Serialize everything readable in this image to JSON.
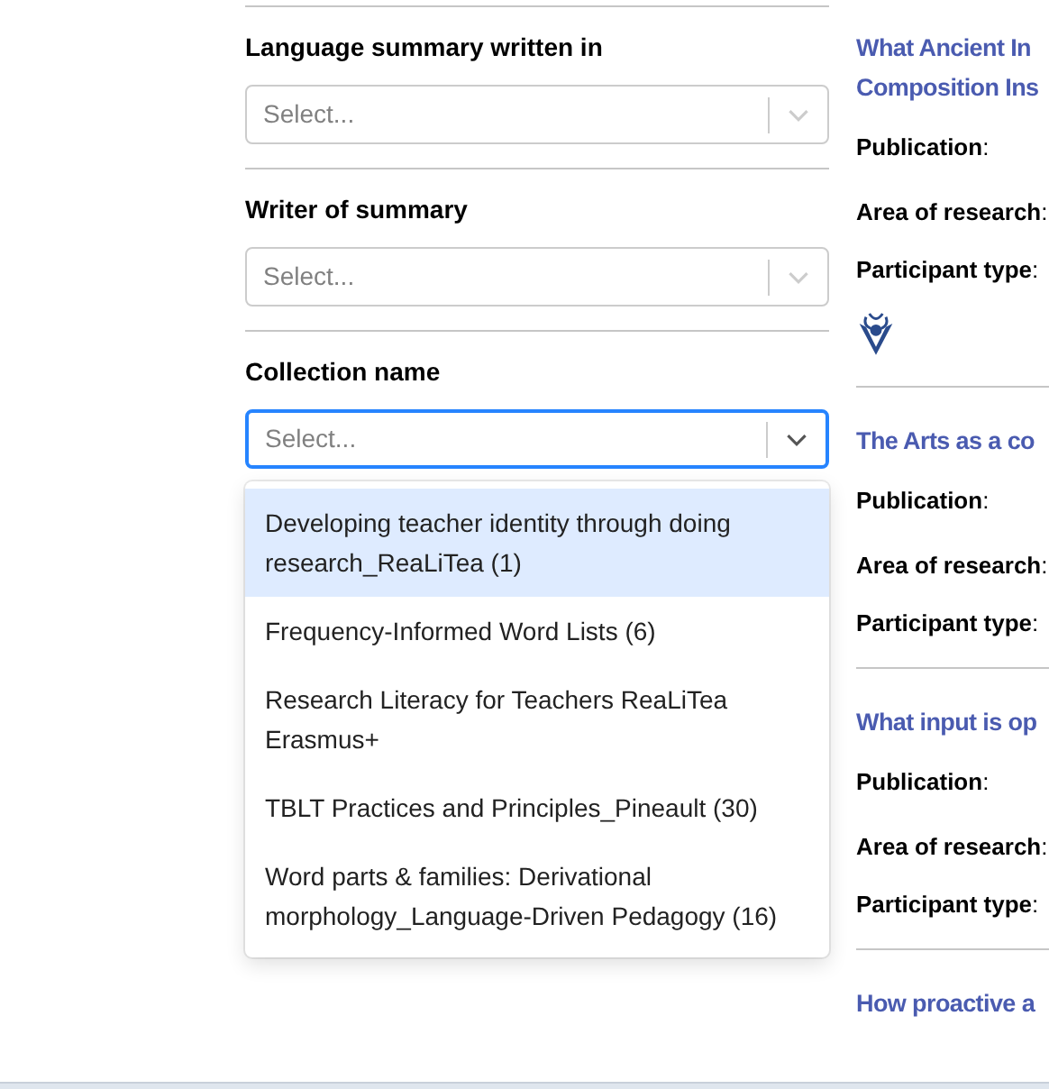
{
  "filters": [
    {
      "label": "Language summary written in",
      "placeholder": "Select...",
      "focused": false
    },
    {
      "label": "Writer of summary",
      "placeholder": "Select...",
      "focused": false
    },
    {
      "label": "Collection name",
      "placeholder": "Select...",
      "focused": true
    }
  ],
  "dropdown_options": [
    {
      "label": "Developing teacher identity through doing research_ReaLiTea (1)",
      "selected": true
    },
    {
      "label": "Frequency-Informed Word Lists (6)",
      "selected": false
    },
    {
      "label": "Research Literacy for Teachers ReaLiTea Erasmus+",
      "selected": false
    },
    {
      "label": "TBLT Practices and Principles_Pineault (30)",
      "selected": false
    },
    {
      "label": "Word parts & families: Derivational morphology_Language-Driven Pedagogy (16)",
      "selected": false
    }
  ],
  "results": [
    {
      "title_lines": [
        "What Ancient In",
        "Composition Ins"
      ],
      "fields": [
        "**Publication**:",
        "**Area of research**:",
        "**Participant type**:"
      ],
      "has_logo": true
    },
    {
      "title_lines": [
        "The Arts as a co"
      ],
      "fields": [
        "**Publication**:",
        "**Area of research**:",
        "**Participant type**:"
      ],
      "has_logo": false
    },
    {
      "title_lines": [
        "What input is op"
      ],
      "fields": [
        "**Publication**:",
        "**Area of research**:",
        "**Participant type**:"
      ],
      "has_logo": false
    },
    {
      "title_lines": [
        "How proactive a"
      ],
      "has_logo": false
    }
  ]
}
